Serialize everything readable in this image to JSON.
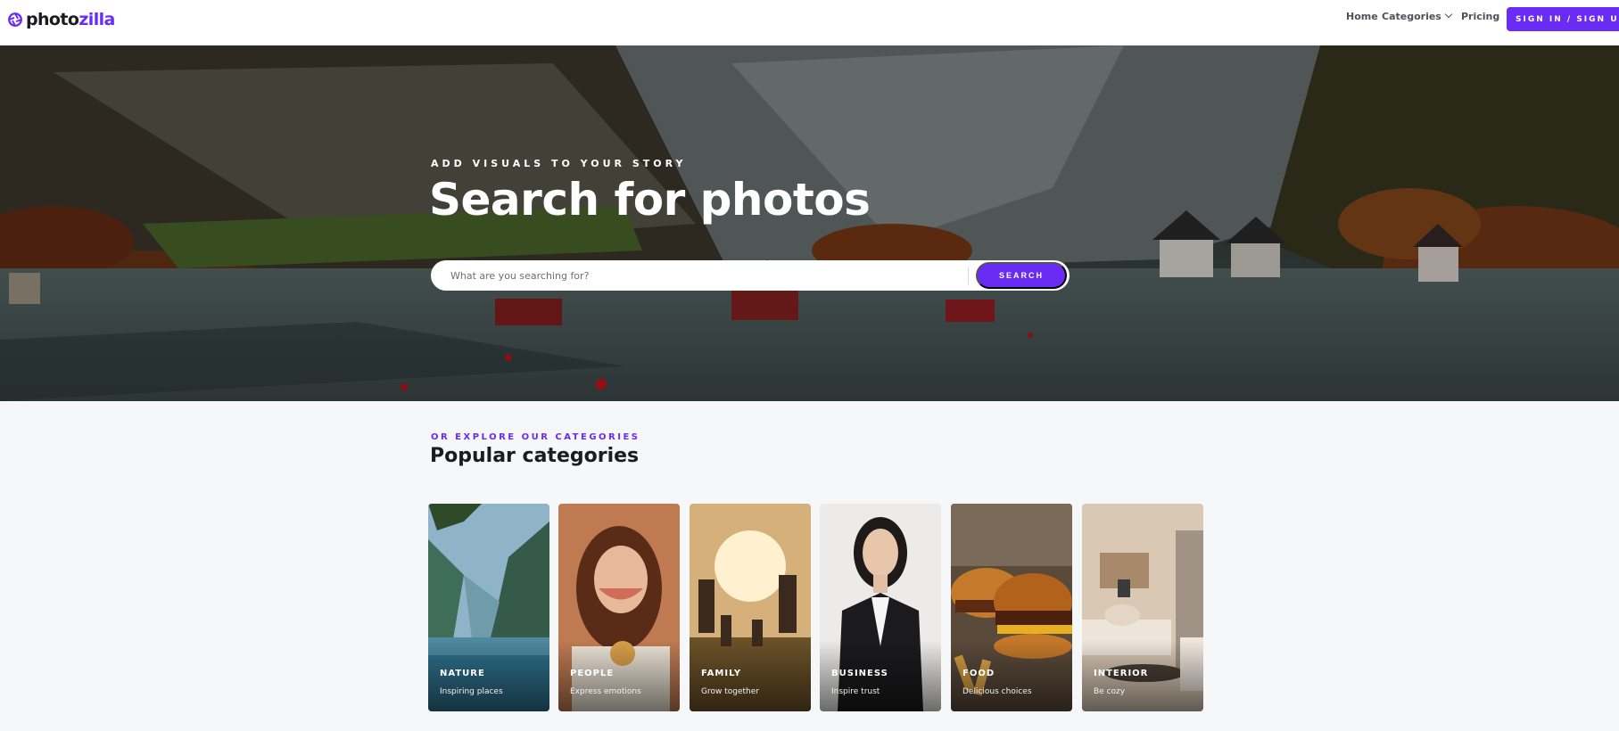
{
  "brand": {
    "name_part1": "photo",
    "name_part2": "zilla",
    "accent_color": "#6a2cf5"
  },
  "nav": {
    "home": "Home",
    "categories": "Categories",
    "pricing": "Pricing",
    "signin": "SIGN IN / SIGN UP"
  },
  "hero": {
    "kicker": "ADD VISUALS TO YOUR STORY",
    "title": "Search for photos",
    "search_placeholder": "What are you searching for?",
    "search_button": "SEARCH"
  },
  "categories": {
    "kicker": "OR EXPLORE OUR CATEGORIES",
    "title": "Popular categories",
    "items": [
      {
        "name": "NATURE",
        "tagline": "Inspiring places"
      },
      {
        "name": "PEOPLE",
        "tagline": "Express emotions"
      },
      {
        "name": "FAMILY",
        "tagline": "Grow together"
      },
      {
        "name": "BUSINESS",
        "tagline": "Inspire trust"
      },
      {
        "name": "FOOD",
        "tagline": "Delicious choices"
      },
      {
        "name": "INTERIOR",
        "tagline": "Be cozy"
      }
    ]
  }
}
